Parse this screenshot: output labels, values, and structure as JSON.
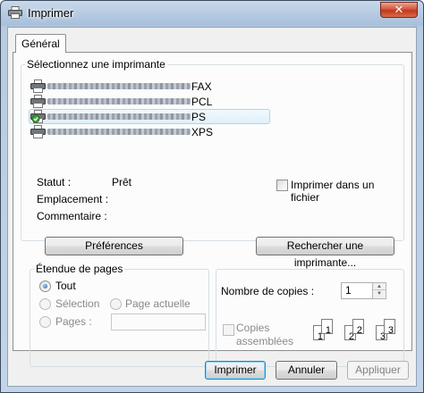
{
  "window": {
    "title": "Imprimer",
    "close_glyph": "✕"
  },
  "tabs": [
    {
      "label": "Général"
    }
  ],
  "printer_group": {
    "legend": "Sélectionnez une imprimante",
    "printers": [
      {
        "suffix": "FAX",
        "selected": false,
        "default": false
      },
      {
        "suffix": "PCL",
        "selected": false,
        "default": false
      },
      {
        "suffix": "PS",
        "selected": true,
        "default": true
      },
      {
        "suffix": "XPS",
        "selected": false,
        "default": false
      }
    ]
  },
  "status": {
    "status_label": "Statut :",
    "status_value": "Prêt",
    "location_label": "Emplacement :",
    "comment_label": "Commentaire :",
    "print_to_file_label": "Imprimer dans un fichier",
    "print_to_file_checked": false
  },
  "buttons": {
    "preferences": "Préférences",
    "find_printer": "Rechercher une imprimante...",
    "print": "Imprimer",
    "cancel": "Annuler",
    "apply": "Appliquer"
  },
  "page_range": {
    "legend": "Étendue de pages",
    "all_label": "Tout",
    "selection_label": "Sélection",
    "current_page_label": "Page actuelle",
    "pages_label": "Pages :",
    "pages_value": "",
    "selected_option": "all"
  },
  "copies": {
    "count_label": "Nombre de copies :",
    "count_value": "1",
    "collate_label_line1": "Copies",
    "collate_label_line2": "assemblées",
    "collate_checked": false,
    "collate_pages": [
      "1",
      "1",
      "2",
      "2",
      "3",
      "3"
    ]
  }
}
